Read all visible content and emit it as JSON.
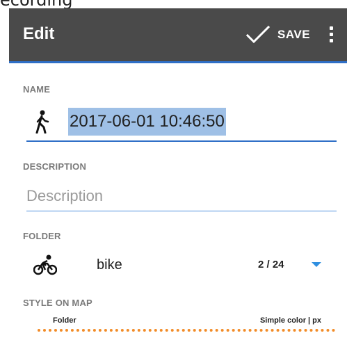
{
  "top_fragment": "ecording",
  "toolbar": {
    "title": "Edit",
    "save_label": "SAVE",
    "save_icon": "check-icon",
    "more_icon": "more-vert-icon",
    "background": "#4a4a4a",
    "accent": "#2f6fc7"
  },
  "name": {
    "label": "NAME",
    "value": "2017-06-01 10:46:50",
    "icon": "walk-icon"
  },
  "description": {
    "label": "DESCRIPTION",
    "placeholder": "Description",
    "value": ""
  },
  "folder": {
    "label": "FOLDER",
    "value": "bike",
    "count": "2 / 24",
    "icon": "bike-icon"
  },
  "style_on_map": {
    "label": "STYLE ON MAP",
    "folder_label": "Folder",
    "type_label": "Simple color | px",
    "line_color": "#f28c28"
  }
}
